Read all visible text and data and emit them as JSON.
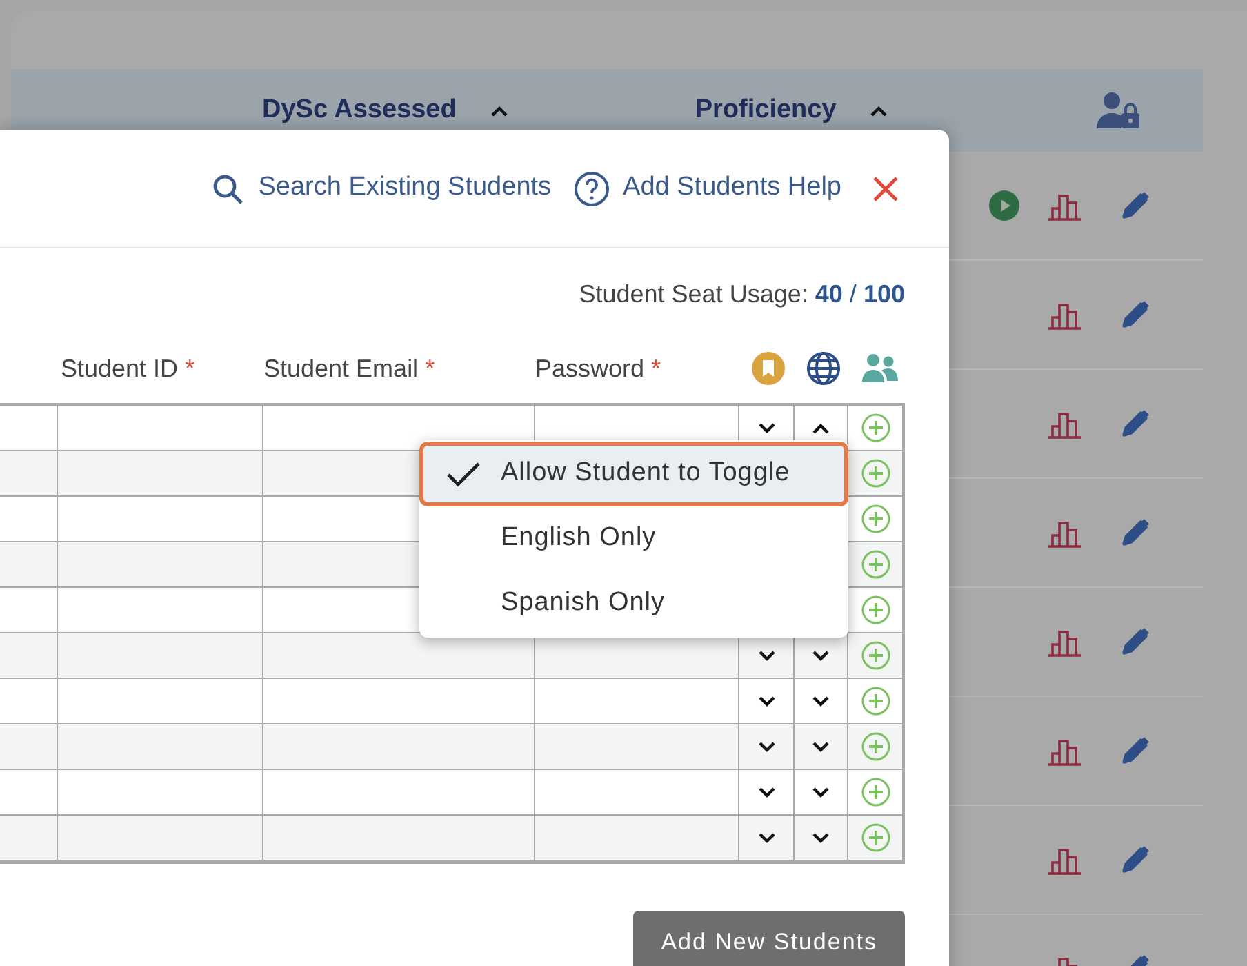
{
  "header": {
    "columns": [
      {
        "label": "DySc Assessed"
      },
      {
        "label": "Proficiency"
      }
    ]
  },
  "background_rows": [
    {
      "play": true
    },
    {
      "play": false
    },
    {
      "play": false
    },
    {
      "play": false
    },
    {
      "play": false
    },
    {
      "play": false
    },
    {
      "play": false
    },
    {
      "play": false
    }
  ],
  "modal": {
    "links": [
      {
        "kind": "search",
        "label": "Search Existing Students"
      },
      {
        "kind": "help",
        "label": "Add Students Help"
      }
    ],
    "seat_usage": {
      "label": "Student Seat Usage:",
      "used": "40",
      "separator": "/",
      "total": "100"
    },
    "columns": [
      {
        "label": "Student ID",
        "marker": "*"
      },
      {
        "label": "Student Email",
        "marker": "*"
      },
      {
        "label": "Password",
        "marker": "*"
      }
    ],
    "rows": [
      {
        "accommodation_open": false,
        "language_open": true
      },
      {},
      {},
      {},
      {},
      {
        "accommodation_open": false,
        "language_open": false
      },
      {
        "accommodation_open": false,
        "language_open": false
      },
      {
        "accommodation_open": false,
        "language_open": false
      },
      {
        "accommodation_open": false,
        "language_open": false
      },
      {
        "accommodation_open": false,
        "language_open": false
      }
    ],
    "menu": [
      {
        "label": "Allow Student to Toggle",
        "selected": true
      },
      {
        "label": "English Only",
        "selected": false
      },
      {
        "label": "Spanish Only",
        "selected": false
      }
    ],
    "submit": "Add New Students"
  }
}
